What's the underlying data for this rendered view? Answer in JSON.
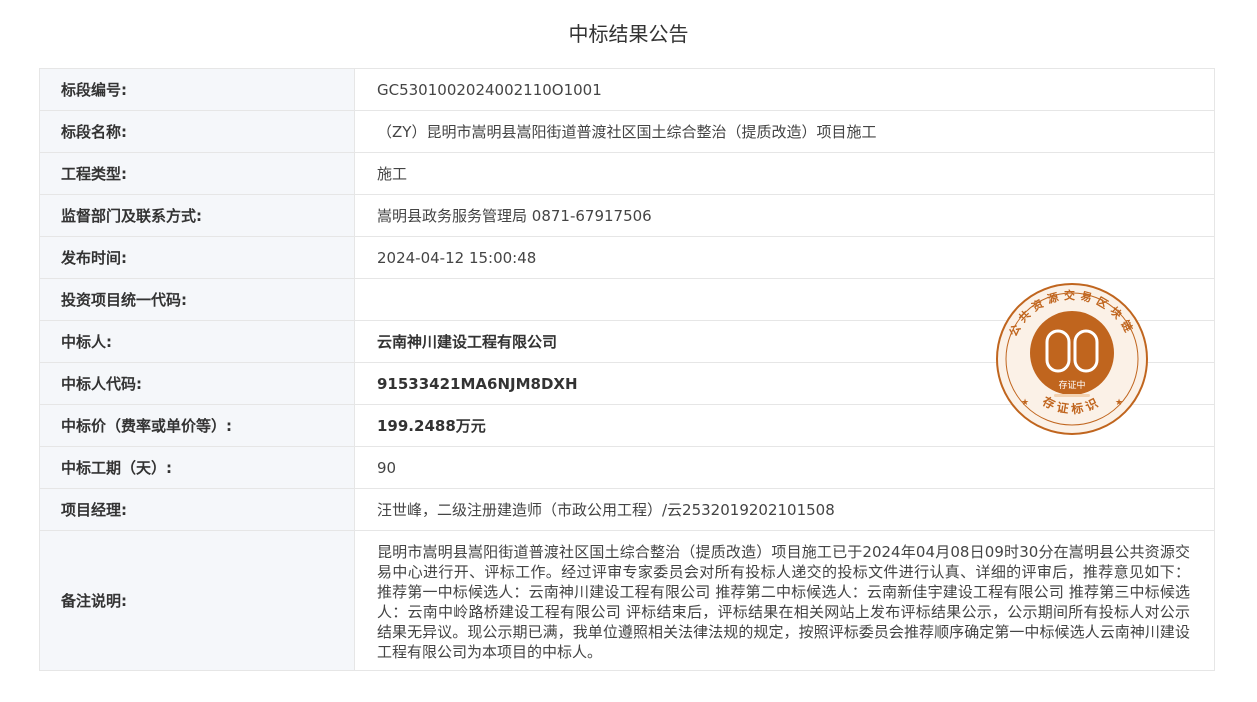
{
  "page": {
    "title": "中标结果公告"
  },
  "rows": [
    {
      "label": "标段编号:",
      "value": "GC5301002024002110O1001"
    },
    {
      "label": "标段名称:",
      "value": "（ZY）昆明市嵩明县嵩阳街道普渡社区国土综合整治（提质改造）项目施工"
    },
    {
      "label": "工程类型:",
      "value": "施工"
    },
    {
      "label": "监督部门及联系方式:",
      "value": "嵩明县政务服务管理局 0871-67917506"
    },
    {
      "label": "发布时间:",
      "value": "2024-04-12 15:00:48"
    },
    {
      "label": "投资项目统一代码:",
      "value": ""
    },
    {
      "label": "中标人:",
      "value": "云南神川建设工程有限公司"
    },
    {
      "label": "中标人代码:",
      "value": "91533421MA6NJM8DXH"
    },
    {
      "label": "中标价（费率或单价等）:",
      "value": "199.2488万元"
    },
    {
      "label": "中标工期（天）:",
      "value": "90"
    },
    {
      "label": "项目经理:",
      "value": "汪世峰，二级注册建造师（市政公用工程）/云2532019202101508"
    },
    {
      "label": "备注说明:",
      "value": "昆明市嵩明县嵩阳街道普渡社区国土综合整治（提质改造）项目施工已于2024年04月08日09时30分在嵩明县公共资源交易中心进行开、评标工作。经过评审专家委员会对所有投标人递交的投标文件进行认真、详细的评审后，推荐意见如下： 推荐第一中标候选人：云南神川建设工程有限公司 推荐第二中标候选人：云南新佳宇建设工程有限公司 推荐第三中标候选人：云南中岭路桥建设工程有限公司 评标结束后，评标结果在相关网站上发布评标结果公示，公示期间所有投标人对公示结果无异议。现公示期已满，我单位遵照相关法律法规的规定，按照评标委员会推荐顺序确定第一中标候选人云南神川建设工程有限公司为本项目的中标人。"
    }
  ],
  "seal": {
    "ring_text": "公共资源交易区块链",
    "center_text": "存证中",
    "bottom_text": "存证标识",
    "color": "#c0651e"
  }
}
